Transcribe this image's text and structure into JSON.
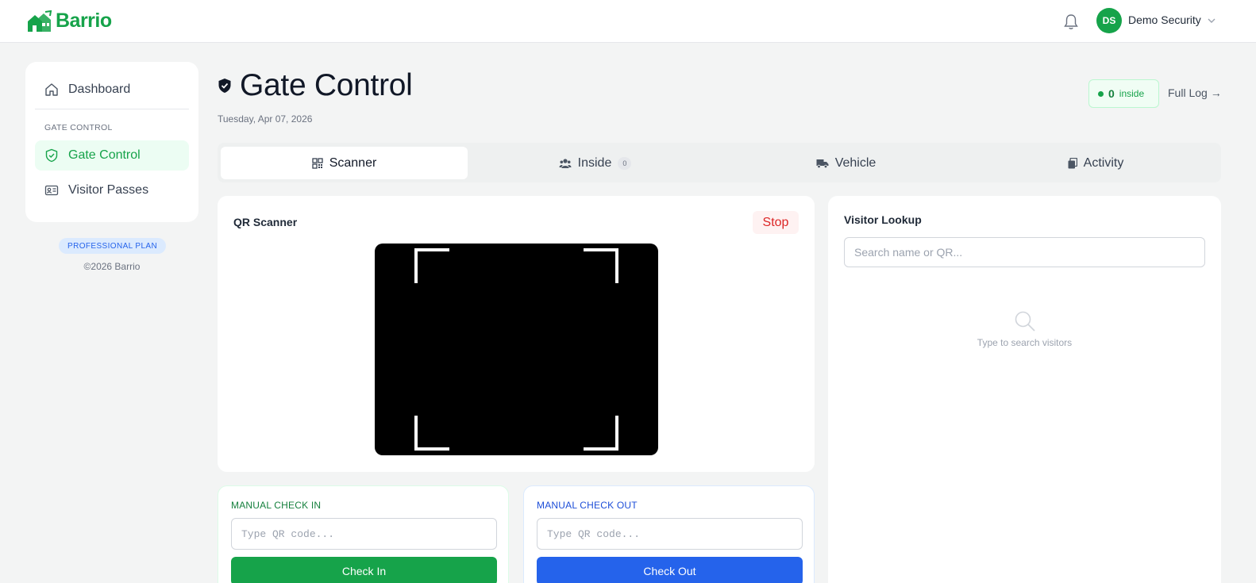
{
  "app": {
    "name": "Barrio",
    "brand_color": "#16a34a"
  },
  "topbar": {
    "notifications_icon": "bell-icon",
    "user": {
      "initials": "DS",
      "name": "Demo Security"
    }
  },
  "sidebar": {
    "items": [
      {
        "label": "Dashboard",
        "icon": "home-icon"
      },
      {
        "label": "Gate Control",
        "icon": "shield-check-icon",
        "active": true
      },
      {
        "label": "Visitor Passes",
        "icon": "id-card-icon"
      }
    ],
    "section_label": "GATE CONTROL",
    "plan_badge": "PROFESSIONAL PLAN",
    "copyright": "©2026 Barrio"
  },
  "header": {
    "title": "Gate Control",
    "date": "Tuesday, Apr 07, 2026",
    "inside_count": "0",
    "inside_label": "inside",
    "full_log": "Full Log →"
  },
  "tabs": [
    {
      "label": "Scanner",
      "icon": "qr-icon",
      "active": true
    },
    {
      "label": "Inside",
      "icon": "users-icon",
      "count": "0"
    },
    {
      "label": "Vehicle",
      "icon": "truck-icon"
    },
    {
      "label": "Activity",
      "icon": "clipboard-icon"
    }
  ],
  "scanner": {
    "title": "QR Scanner",
    "stop_label": "Stop"
  },
  "lookup": {
    "title": "Visitor Lookup",
    "placeholder": "Search name or QR...",
    "empty_text": "Type to search visitors"
  },
  "manual_in": {
    "title": "MANUAL CHECK IN",
    "placeholder": "Type QR code...",
    "button": "Check In",
    "color": "#16a34a"
  },
  "manual_out": {
    "title": "MANUAL CHECK OUT",
    "placeholder": "Type QR code...",
    "button": "Check Out",
    "color": "#2563eb"
  }
}
